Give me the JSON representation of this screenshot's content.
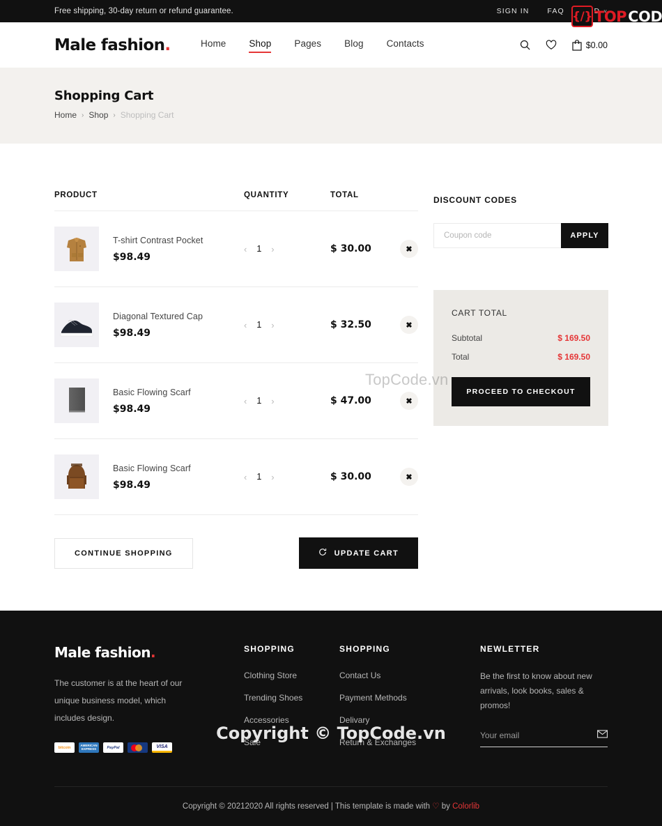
{
  "topbar": {
    "promo": "Free shipping, 30-day return or refund guarantee.",
    "sign_in": "SIGN IN",
    "faq": "FAQ",
    "currency": "USD",
    "caret": "˅"
  },
  "header": {
    "logo": "Male fashion",
    "logo_dot": ".",
    "nav": [
      {
        "label": "Home",
        "active": false
      },
      {
        "label": "Shop",
        "active": true
      },
      {
        "label": "Pages",
        "active": false
      },
      {
        "label": "Blog",
        "active": false
      },
      {
        "label": "Contacts",
        "active": false
      }
    ],
    "icons": {
      "search": "search-icon",
      "wishlist": "heart-icon",
      "cart": "bag-icon"
    },
    "cart_price": "$0.00"
  },
  "breadcrumb": {
    "title": "Shopping Cart",
    "links": [
      {
        "label": "Home",
        "current": false
      },
      {
        "label": "Shop",
        "current": false
      },
      {
        "label": "Shopping Cart",
        "current": true
      }
    ],
    "separator": "›"
  },
  "cart": {
    "columns": {
      "product": "PRODUCT",
      "quantity": "QUANTITY",
      "total": "TOTAL"
    },
    "items": [
      {
        "name": "T-shirt Contrast Pocket",
        "price": "$98.49",
        "qty": "1",
        "total": "$ 30.00",
        "thumb": "jacket-thumbnail"
      },
      {
        "name": "Diagonal Textured Cap",
        "price": "$98.49",
        "qty": "1",
        "total": "$ 32.50",
        "thumb": "sneaker-thumbnail"
      },
      {
        "name": "Basic Flowing Scarf",
        "price": "$98.49",
        "qty": "1",
        "total": "$ 47.00",
        "thumb": "scarf-thumbnail"
      },
      {
        "name": "Basic Flowing Scarf",
        "price": "$98.49",
        "qty": "1",
        "total": "$ 30.00",
        "thumb": "backpack-thumbnail"
      }
    ],
    "qty_decrement": "‹",
    "qty_increment": "›",
    "remove_glyph": "✖",
    "continue_shopping": "CONTINUE SHOPPING",
    "update_cart": "UPDATE CART"
  },
  "sidebar": {
    "discount_title": "DISCOUNT CODES",
    "coupon_placeholder": "Coupon code",
    "coupon_value": "",
    "apply_label": "APPLY",
    "cart_total_title": "CART TOTAL",
    "rows": [
      {
        "label": "Subtotal",
        "value": "$ 169.50"
      },
      {
        "label": "Total",
        "value": "$ 169.50"
      }
    ],
    "checkout_label": "PROCEED TO CHECKOUT",
    "accent_color": "#e53637"
  },
  "footer": {
    "logo": "Male fashion",
    "logo_dot": ".",
    "about": "The customer is at the heart of our unique business model, which includes design.",
    "payments": [
      {
        "name": "bitcoin-icon",
        "label": "bitcoin"
      },
      {
        "name": "amex-icon",
        "label": "AMERICAN EXPRESS"
      },
      {
        "name": "paypal-icon",
        "label": "PayPal"
      },
      {
        "name": "mastercard-icon",
        "label": ""
      },
      {
        "name": "visa-icon",
        "label": "VISA"
      }
    ],
    "columns": [
      {
        "heading": "SHOPPING",
        "links": [
          "Clothing Store",
          "Trending Shoes",
          "Accessories",
          "Sale"
        ]
      },
      {
        "heading": "SHOPPING",
        "links": [
          "Contact Us",
          "Payment Methods",
          "Delivary",
          "Return & Exchanges"
        ]
      }
    ],
    "newsletter": {
      "heading": "NEWLETTER",
      "text": "Be the first to know about new arrivals, look books, sales & promos!",
      "placeholder": "Your email",
      "value": "",
      "submit_icon": "envelope-icon"
    },
    "copyright_pre": "Copyright © 20212020 All rights reserved | This template is made with ",
    "copyright_heart": "♡",
    "copyright_by": " by ",
    "copyright_brand": "Colorlib"
  },
  "watermarks": {
    "top_brace": "{/}",
    "top_red": "TOP",
    "top_white": "CODE.VN",
    "middle": "TopCode.vn",
    "footer": "Copyright © TopCode.vn"
  }
}
